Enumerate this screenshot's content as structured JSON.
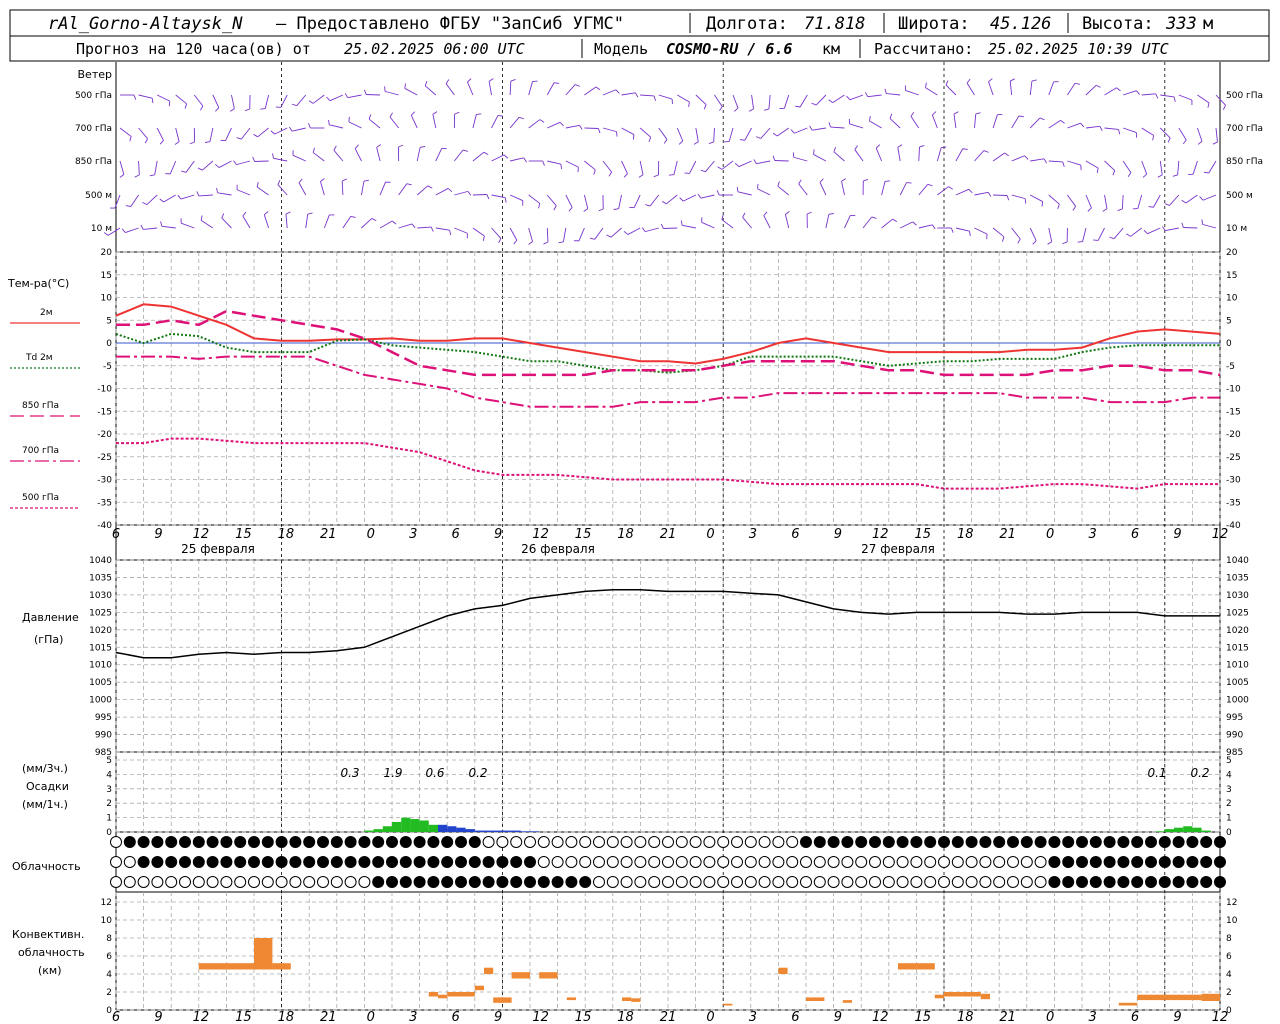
{
  "header": {
    "station": "rAl_Gorno-Altaysk_N",
    "provider": "– Предоставлено ФГБУ \"ЗапСиб УГМС\"",
    "lon_label": "Долгота:",
    "lon": "71.818",
    "lat_label": "Широта:",
    "lat": "45.126",
    "alt_label": "Высота:",
    "alt": "333",
    "alt_unit": "м",
    "forecast_prefix": "Прогноз на 120 часа(ов) от",
    "forecast_time": "25.02.2025 06:00 UTC",
    "model_label": "Модель",
    "model": "COSMO-RU / 6.6",
    "model_unit": "км",
    "calc_label": "Рассчитано:",
    "calc_time": "25.02.2025 10:39 UTC"
  },
  "wind_panel": {
    "title": "Ветер",
    "levels": [
      "500 гПа",
      "700 гПа",
      "850 гПа",
      "500 м",
      "10  м"
    ]
  },
  "temp_panel": {
    "title": "Тем-ра(°C)",
    "legend": [
      {
        "label": "2м",
        "color": "#ee3333"
      },
      {
        "label": "Td  2м",
        "color": "#117711"
      },
      {
        "label": "850 гПа",
        "color": "#dd1177"
      },
      {
        "label": "700 гПа",
        "color": "#dd1177"
      },
      {
        "label": "500 гПа",
        "color": "#dd1177"
      }
    ],
    "yticks": [
      "20",
      "15",
      "10",
      "5",
      "0",
      "-5",
      "-10",
      "-15",
      "-20",
      "-25",
      "-30",
      "-35",
      "-40"
    ]
  },
  "x_axis": {
    "hours": [
      "6",
      "9",
      "12",
      "15",
      "18",
      "21",
      "0",
      "3",
      "6",
      "9",
      "12",
      "15",
      "18",
      "21",
      "0",
      "3",
      "6",
      "9",
      "12",
      "15",
      "18",
      "21",
      "0",
      "3",
      "6",
      "9",
      "12"
    ],
    "dates": [
      "25 февраля",
      "26 февраля",
      "27 февраля"
    ]
  },
  "pressure_panel": {
    "title": "Давление",
    "unit": "(гПа)",
    "yticks": [
      "1040",
      "1035",
      "1030",
      "1025",
      "1020",
      "1015",
      "1010",
      "1005",
      "1000",
      "995",
      "990",
      "985"
    ]
  },
  "precip_panel": {
    "unit3": "(мм/3ч.)",
    "title": "Осадки",
    "unit1": "(мм/1ч.)",
    "yticks": [
      "5",
      "4",
      "3",
      "2",
      "1",
      "0"
    ],
    "totals": [
      "0.3",
      "1.9",
      "0.6",
      "0.2",
      "0.1",
      "0.2"
    ]
  },
  "cloud_panel": {
    "title": "Облачность"
  },
  "conv_panel": {
    "title1": "Конвективн.",
    "title2": "облачность",
    "unit": "(км)",
    "yticks": [
      "12",
      "10",
      "8",
      "6",
      "4",
      "2",
      "0"
    ]
  },
  "chart_data": [
    {
      "type": "line",
      "title": "Тем-ра(°C)",
      "ylim": [
        -40,
        20
      ],
      "x_hours": [
        0,
        3,
        6,
        9,
        12,
        15,
        18,
        21,
        24,
        27,
        30,
        33,
        36,
        39,
        42,
        45,
        48,
        51,
        54,
        57,
        60,
        63,
        66,
        69,
        72,
        75,
        78,
        81,
        84,
        87,
        90,
        93,
        96,
        99,
        102,
        105,
        108,
        111,
        114,
        117,
        120
      ],
      "series": [
        {
          "name": "2м",
          "values": [
            6,
            8.5,
            8,
            6,
            4,
            1,
            0.5,
            0.5,
            0.8,
            0.8,
            1,
            0.5,
            0.5,
            1,
            1,
            0,
            -1,
            -2,
            -3,
            -4,
            -4,
            -4.5,
            -3.5,
            -2,
            0,
            1,
            0,
            -1,
            -2,
            -2,
            -2,
            -2,
            -2,
            -1.5,
            -1.5,
            -1,
            1,
            2.5,
            3,
            2.5,
            2
          ]
        },
        {
          "name": "Td  2м",
          "values": [
            2,
            0,
            2,
            1.5,
            -1,
            -2,
            -2,
            -2,
            0.5,
            0.8,
            -0.5,
            -1,
            -1.5,
            -2,
            -3,
            -4,
            -4,
            -5,
            -6,
            -6,
            -6.5,
            -6,
            -5,
            -3,
            -3,
            -3,
            -3,
            -4,
            -5,
            -4.5,
            -4,
            -4,
            -3.5,
            -3.5,
            -3.5,
            -2,
            -1,
            -0.5,
            -0.5,
            -0.5,
            -0.5
          ]
        },
        {
          "name": "850 гПа",
          "values": [
            4,
            4,
            5,
            4,
            7,
            6,
            5,
            4,
            3,
            1,
            -2,
            -5,
            -6,
            -7,
            -7,
            -7,
            -7,
            -7,
            -6,
            -6,
            -6,
            -6,
            -5,
            -4,
            -4,
            -4,
            -4,
            -5,
            -6,
            -6,
            -7,
            -7,
            -7,
            -7,
            -6,
            -6,
            -5,
            -5,
            -6,
            -6,
            -7
          ]
        },
        {
          "name": "700 гПа",
          "values": [
            -3,
            -3,
            -3,
            -3.5,
            -3,
            -3,
            -3,
            -3,
            -5,
            -7,
            -8,
            -9,
            -10,
            -12,
            -13,
            -14,
            -14,
            -14,
            -14,
            -13,
            -13,
            -13,
            -12,
            -12,
            -11,
            -11,
            -11,
            -11,
            -11,
            -11,
            -11,
            -11,
            -11,
            -12,
            -12,
            -12,
            -13,
            -13,
            -13,
            -12,
            -12
          ]
        },
        {
          "name": "500 гПа",
          "values": [
            -22,
            -22,
            -21,
            -21,
            -21.5,
            -22,
            -22,
            -22,
            -22,
            -22,
            -23,
            -24,
            -26,
            -28,
            -29,
            -29,
            -29,
            -29.5,
            -30,
            -30,
            -30,
            -30,
            -30,
            -30.5,
            -31,
            -31,
            -31,
            -31,
            -31,
            -31,
            -32,
            -32,
            -32,
            -31.5,
            -31,
            -31,
            -31.5,
            -32,
            -31,
            -31,
            -31
          ]
        }
      ]
    },
    {
      "type": "line",
      "title": "Давление",
      "ylim": [
        985,
        1040
      ],
      "x_hours": [
        0,
        3,
        6,
        9,
        12,
        15,
        18,
        21,
        24,
        27,
        30,
        33,
        36,
        39,
        42,
        45,
        48,
        51,
        54,
        57,
        60,
        63,
        66,
        69,
        72,
        75,
        78,
        81,
        84,
        87,
        90,
        93,
        96,
        99,
        102,
        105,
        108,
        111,
        114,
        117,
        120
      ],
      "series": [
        {
          "name": "",
          "values": [
            1013.5,
            1012,
            1012,
            1013,
            1013.5,
            1013,
            1013.5,
            1013.5,
            1014,
            1015,
            1018,
            1021,
            1024,
            1026,
            1027,
            1029,
            1030,
            1031,
            1031.5,
            1031.5,
            1031,
            1031,
            1031,
            1030.5,
            1030,
            1028,
            1026,
            1025,
            1024.5,
            1025,
            1025,
            1025,
            1025,
            1024.5,
            1024.5,
            1025,
            1025,
            1025,
            1024,
            1024,
            1024
          ]
        }
      ]
    },
    {
      "type": "bar",
      "title": "Осадки",
      "ylim": [
        0,
        5
      ],
      "x_hours": [
        27,
        28,
        29,
        30,
        31,
        32,
        33,
        34,
        35,
        36,
        37,
        38,
        39,
        40,
        41,
        42,
        43,
        44,
        45,
        113,
        114,
        115,
        116,
        117,
        118
      ],
      "values": [
        0.1,
        0.2,
        0.4,
        0.7,
        1.0,
        0.9,
        0.8,
        0.5,
        0.5,
        0.4,
        0.3,
        0.2,
        0.1,
        0.1,
        0.1,
        0.1,
        0.1,
        0.05,
        0.05,
        0.05,
        0.2,
        0.3,
        0.4,
        0.3,
        0.1
      ]
    },
    {
      "type": "bar",
      "title": "Конвективн. облачность",
      "ylim": [
        0,
        12
      ],
      "segments": [
        {
          "x0": 9,
          "x1": 12,
          "bottom": 4.5,
          "top": 5.2
        },
        {
          "x0": 12,
          "x1": 15,
          "bottom": 4.5,
          "top": 5.2
        },
        {
          "x0": 15,
          "x1": 17,
          "bottom": 4.5,
          "top": 8
        },
        {
          "x0": 17,
          "x1": 19,
          "bottom": 4.5,
          "top": 5.2
        },
        {
          "x0": 34,
          "x1": 35,
          "bottom": 1.5,
          "top": 2
        },
        {
          "x0": 35,
          "x1": 36,
          "bottom": 1.3,
          "top": 1.7
        },
        {
          "x0": 36,
          "x1": 39,
          "bottom": 1.5,
          "top": 2
        },
        {
          "x0": 39,
          "x1": 40,
          "bottom": 2.2,
          "top": 2.7
        },
        {
          "x0": 40,
          "x1": 41,
          "bottom": 4.0,
          "top": 4.7
        },
        {
          "x0": 41,
          "x1": 43,
          "bottom": 0.8,
          "top": 1.4
        },
        {
          "x0": 43,
          "x1": 45,
          "bottom": 3.5,
          "top": 4.2
        },
        {
          "x0": 46,
          "x1": 48,
          "bottom": 3.5,
          "top": 4.2
        },
        {
          "x0": 49,
          "x1": 50,
          "bottom": 1.1,
          "top": 1.4
        },
        {
          "x0": 55,
          "x1": 56,
          "bottom": 1.0,
          "top": 1.4
        },
        {
          "x0": 56,
          "x1": 57,
          "bottom": 0.9,
          "top": 1.3
        },
        {
          "x0": 66,
          "x1": 67,
          "bottom": 0.5,
          "top": 0.7
        },
        {
          "x0": 72,
          "x1": 73,
          "bottom": 4,
          "top": 4.7
        },
        {
          "x0": 75,
          "x1": 77,
          "bottom": 1.0,
          "top": 1.4
        },
        {
          "x0": 79,
          "x1": 80,
          "bottom": 0.8,
          "top": 1.1
        },
        {
          "x0": 85,
          "x1": 87,
          "bottom": 4.5,
          "top": 5.2
        },
        {
          "x0": 87,
          "x1": 89,
          "bottom": 4.5,
          "top": 5.2
        },
        {
          "x0": 89,
          "x1": 90,
          "bottom": 1.3,
          "top": 1.7
        },
        {
          "x0": 90,
          "x1": 92,
          "bottom": 1.5,
          "top": 2
        },
        {
          "x0": 92,
          "x1": 94,
          "bottom": 1.5,
          "top": 2
        },
        {
          "x0": 94,
          "x1": 95,
          "bottom": 1.2,
          "top": 1.8
        },
        {
          "x0": 109,
          "x1": 111,
          "bottom": 0.5,
          "top": 0.8
        },
        {
          "x0": 111,
          "x1": 114,
          "bottom": 1.1,
          "top": 1.7
        },
        {
          "x0": 114,
          "x1": 118,
          "bottom": 1.1,
          "top": 1.7
        },
        {
          "x0": 118,
          "x1": 120,
          "bottom": 1.0,
          "top": 1.8
        }
      ]
    }
  ]
}
